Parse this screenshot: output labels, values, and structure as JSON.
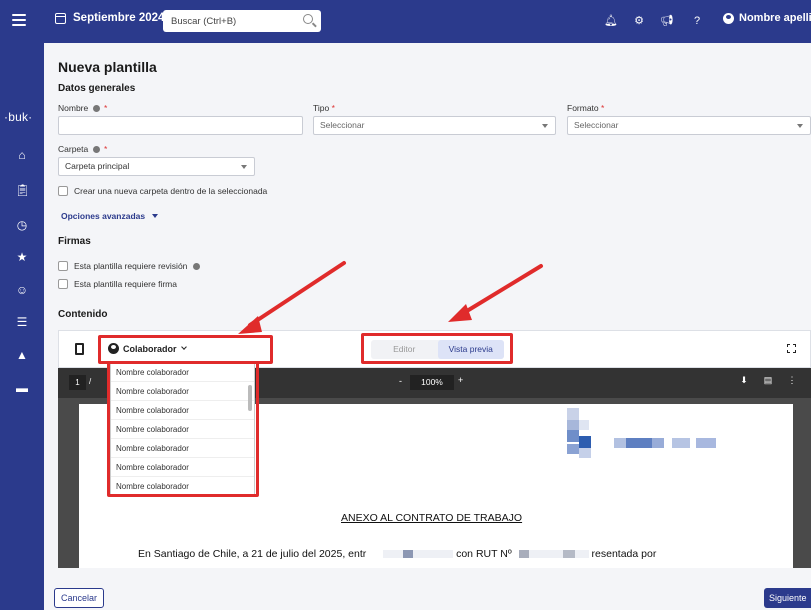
{
  "topbar": {
    "date_label": "Septiembre 2024",
    "search_placeholder": "Buscar (Ctrl+B)",
    "user_name": "Nombre apellido"
  },
  "sidebar": {
    "logo": "·buk·",
    "icons": [
      "home-icon",
      "clipboard-icon",
      "clock-icon",
      "star-icon",
      "user-check-icon",
      "people-icon",
      "graduation-icon",
      "folder-icon"
    ]
  },
  "form": {
    "title": "Nueva plantilla",
    "general_title": "Datos generales",
    "name_label": "Nombre",
    "type_label": "Tipo",
    "type_value": "Seleccionar",
    "format_label": "Formato",
    "format_value": "Seleccionar",
    "folder_label": "Carpeta",
    "folder_value": "Carpeta principal",
    "create_folder_label": "Crear una nueva carpeta dentro de la seleccionada",
    "advanced_label": "Opciones avanzadas",
    "signatures_title": "Firmas",
    "review_label": "Esta plantilla requiere revisión",
    "sign_label": "Esta plantilla requiere firma",
    "content_title": "Contenido",
    "required_mark": "*"
  },
  "editor": {
    "collaborator_label": "Colaborador",
    "tab_editor": "Editor",
    "tab_preview": "Vista previa",
    "dropdown_items": [
      "Nombre colaborador",
      "Nombre colaborador",
      "Nombre colaborador",
      "Nombre colaborador",
      "Nombre colaborador",
      "Nombre colaborador",
      "Nombre colaborador"
    ]
  },
  "pdf": {
    "page_current": "1",
    "page_sep": "/",
    "zoom_minus": "-",
    "zoom": "100%",
    "zoom_plus": "+",
    "heading": "ANEXO AL CONTRATO DE TRABAJO",
    "body_part1": "En Santiago de Chile, a 21 de julio del 2025, entr",
    "body_part2": "con RUT Nº",
    "body_part3": "resentada por"
  },
  "footer": {
    "cancel": "Cancelar",
    "next": "Siguiente"
  },
  "colors": {
    "primary": "#2b3a8c",
    "highlight": "#e02b2b"
  }
}
